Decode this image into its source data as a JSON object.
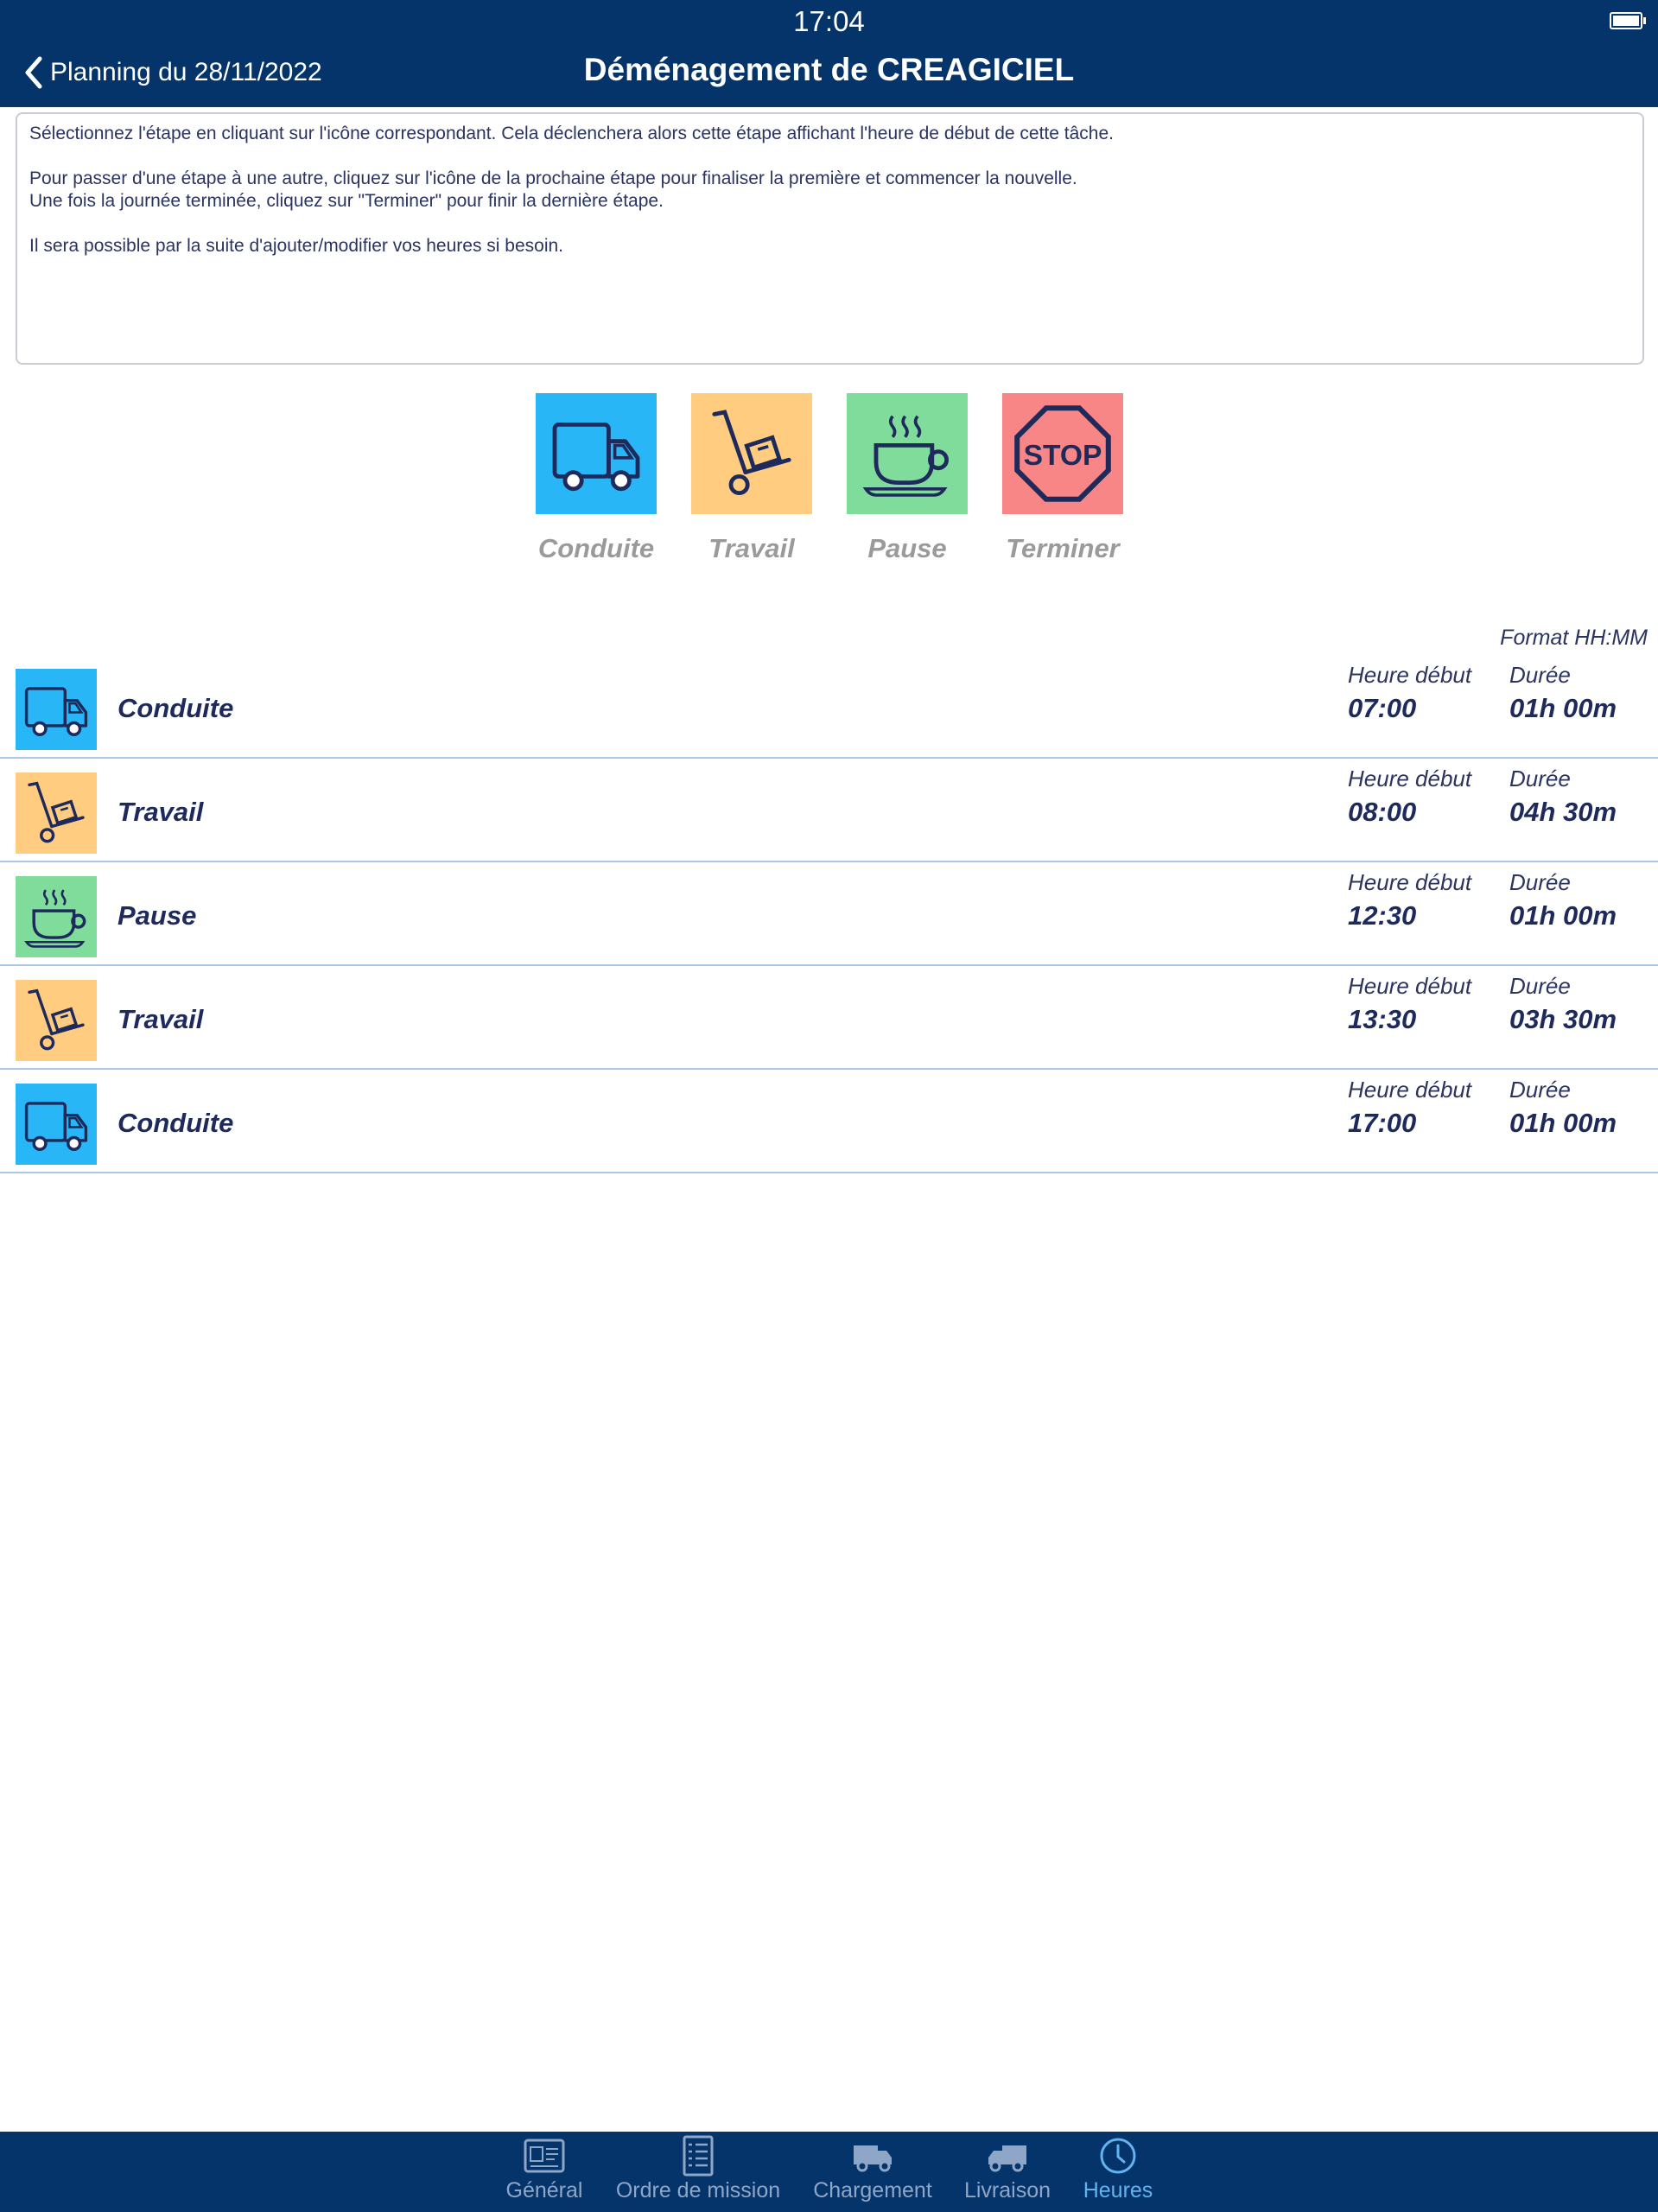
{
  "status_bar": {
    "time": "17:04"
  },
  "nav": {
    "back_label": "Planning du 28/11/2022",
    "title": "Déménagement de CREAGICIEL"
  },
  "instructions": {
    "line1": "Sélectionnez l'étape en cliquant sur l'icône correspondant. Cela déclenchera alors cette étape affichant l'heure de début de cette tâche.",
    "line2": "Pour passer d'une étape à une autre, cliquez sur l'icône de la prochaine étape pour finaliser la première et commencer la nouvelle.",
    "line3": "Une fois la journée terminée, cliquez sur \"Terminer\" pour finir la dernière étape.",
    "line4": "Il sera possible par la suite d'ajouter/modifier vos heures si besoin."
  },
  "actions": [
    {
      "label": "Conduite",
      "icon": "truck-icon",
      "color": "#29b6f6"
    },
    {
      "label": "Travail",
      "icon": "hand-truck-icon",
      "color": "#ffcc80"
    },
    {
      "label": "Pause",
      "icon": "coffee-cup-icon",
      "color": "#7fdc9a"
    },
    {
      "label": "Terminer",
      "icon": "stop-sign-icon",
      "color": "#f88686"
    }
  ],
  "format_label": "Format HH:MM",
  "column_headers": {
    "start": "Heure début",
    "duration": "Durée"
  },
  "entries": [
    {
      "name": "Conduite",
      "start": "07:00",
      "duration": "01h 00m",
      "icon": "truck-icon"
    },
    {
      "name": "Travail",
      "start": "08:00",
      "duration": "04h 30m",
      "icon": "hand-truck-icon"
    },
    {
      "name": "Pause",
      "start": "12:30",
      "duration": "01h 00m",
      "icon": "coffee-cup-icon"
    },
    {
      "name": "Travail",
      "start": "13:30",
      "duration": "03h 30m",
      "icon": "hand-truck-icon"
    },
    {
      "name": "Conduite",
      "start": "17:00",
      "duration": "01h 00m",
      "icon": "truck-icon"
    }
  ],
  "tabs": [
    {
      "label": "Général",
      "icon": "id-card-icon",
      "active": false
    },
    {
      "label": "Ordre de mission",
      "icon": "checklist-icon",
      "active": false
    },
    {
      "label": "Chargement",
      "icon": "truck-icon",
      "active": false
    },
    {
      "label": "Livraison",
      "icon": "delivery-truck-icon",
      "active": false
    },
    {
      "label": "Heures",
      "icon": "clock-icon",
      "active": true
    }
  ],
  "colors": {
    "navbar": "#05346a",
    "drive": "#29b6f6",
    "work": "#ffcc80",
    "pause": "#7fdc9a",
    "stop": "#f88686",
    "text_dark": "#1e2a5c",
    "tab_active": "#63b3f0"
  }
}
